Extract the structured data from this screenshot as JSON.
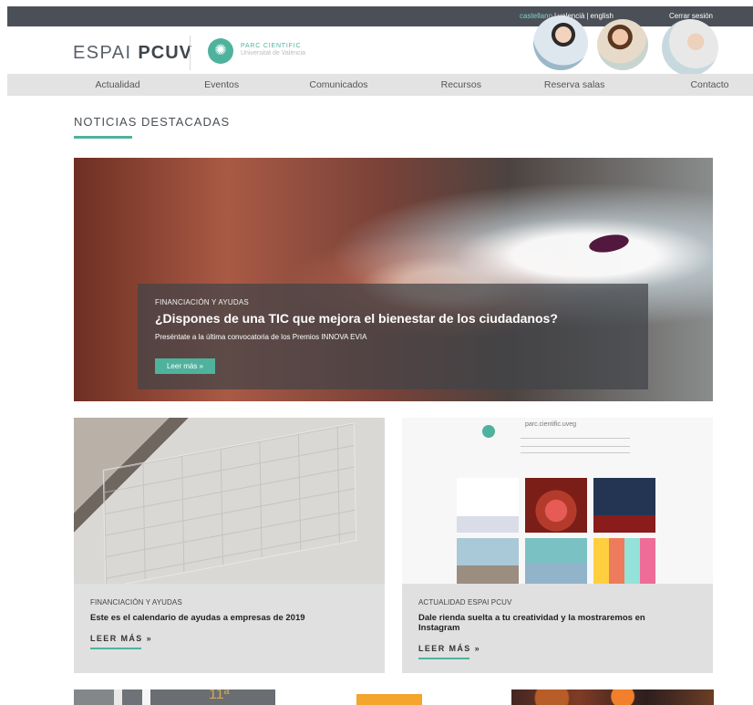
{
  "topbar": {
    "languages": [
      "castellano",
      "valencià",
      "english"
    ],
    "separator": "|",
    "logout": "Cerrar sesión"
  },
  "header": {
    "brand_left": "ESPAI",
    "brand_right": "PCUV",
    "partner_line1": "PARC CIENTIFIC",
    "partner_line2": "Universitat de València"
  },
  "nav": {
    "items": [
      "Actualidad",
      "Eventos",
      "Comunicados",
      "Recursos",
      "Reserva salas",
      "Contacto"
    ]
  },
  "section": {
    "title": "NOTICIAS DESTACADAS"
  },
  "hero": {
    "category": "FINANCIACIÓN Y AYUDAS",
    "title": "¿Dispones de una TIC que mejora el bienestar de los ciudadanos?",
    "subtitle": "Preséntate a la última convocatoria de los Premios INNOVA EVIA",
    "button": "Leer más »"
  },
  "cards": [
    {
      "category": "FINANCIACIÓN Y AYUDAS",
      "title": "Este es el calendario de ayudas a empresas de 2019",
      "link": "LEER MÁS »"
    },
    {
      "category": "ACTUALIDAD ESPAI PCUV",
      "title": "Dale rienda suelta a tu creatividad y la mostraremos en Instagram",
      "link": "LEER MÁS »"
    }
  ],
  "instagram_preview": {
    "account": "parc.cientific.uveg"
  },
  "bottom": {
    "promo_text": "11ª"
  },
  "colors": {
    "accent": "#4fb29d",
    "topbar": "#4b5058",
    "nav": "#e3e3e3",
    "card": "#e0e0e0"
  }
}
